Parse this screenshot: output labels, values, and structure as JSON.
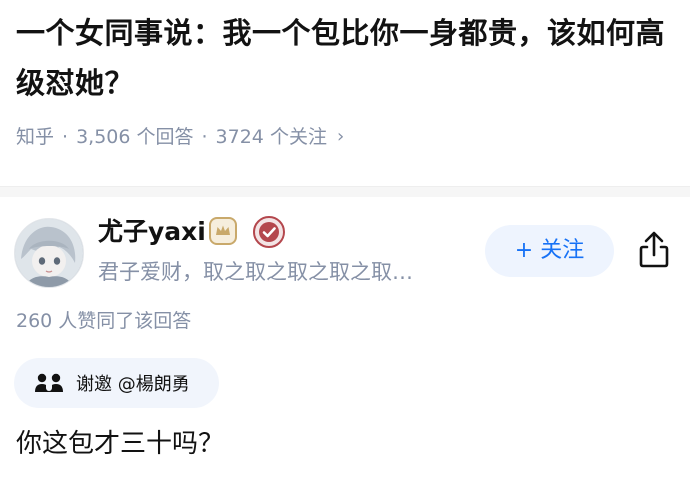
{
  "question": {
    "title": "一个女同事说：我一个包比你一身都贵，该如何高级怼她？",
    "source": "知乎",
    "answer_count": "3,506 个回答",
    "follow_count": "3724 个关注",
    "chevron": "›"
  },
  "author": {
    "name": "尤子yaxi",
    "bio": "君子爱财，取之取之取之取之取…",
    "follow_label": "+ 关注",
    "level_badge_color": "#c9a96b",
    "verify_badge_color": "#b4474d"
  },
  "answer": {
    "upvote_text": "260 人赞同了该回答",
    "invite_text": "谢邀 @楊朗勇",
    "content": "你这包才三十吗？"
  },
  "colors": {
    "accent": "#1772f6",
    "meta": "#8590a6",
    "text": "#121212"
  }
}
